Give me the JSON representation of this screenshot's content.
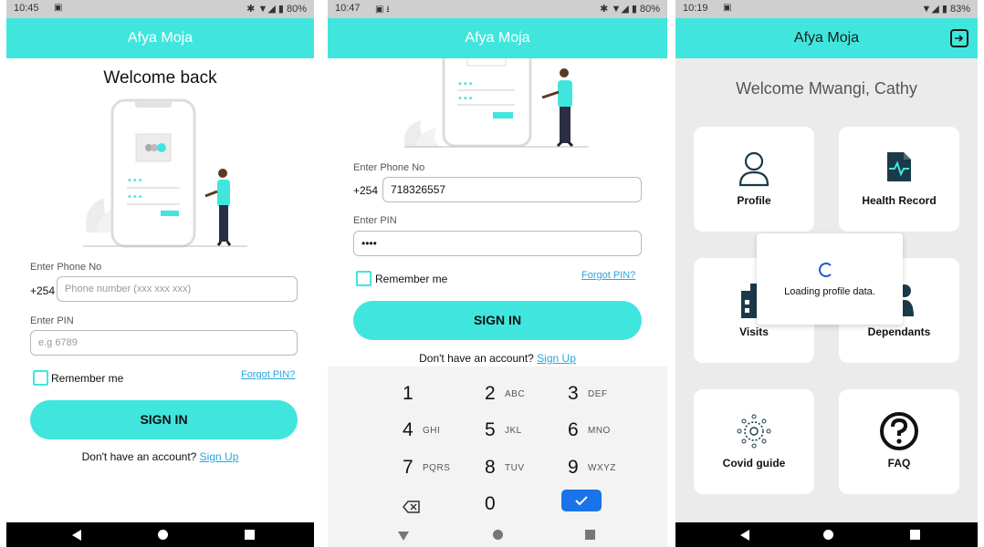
{
  "screen1": {
    "status": {
      "time": "10:45",
      "battery": "80%"
    },
    "app_title": "Afya Moja",
    "welcome": "Welcome back",
    "phone_label": "Enter Phone No",
    "phone_prefix": "+254",
    "phone_placeholder": "Phone number (xxx xxx xxx)",
    "pin_label": "Enter PIN",
    "pin_placeholder": "e.g 6789",
    "remember": "Remember me",
    "forgot": "Forgot PIN?",
    "signin": "SIGN IN",
    "no_account": "Don't have an account?",
    "signup": "Sign Up"
  },
  "screen2": {
    "status": {
      "time": "10:47",
      "battery": "80%"
    },
    "app_title": "Afya Moja",
    "phone_label": "Enter Phone No",
    "phone_prefix": "+254",
    "phone_value": "718326557",
    "pin_label": "Enter PIN",
    "pin_value": "••••",
    "remember": "Remember me",
    "forgot": "Forgot PIN?",
    "signin": "SIGN IN",
    "no_account": "Don't have an account?",
    "signup": "Sign Up",
    "keys": [
      {
        "num": "1",
        "letters": ""
      },
      {
        "num": "2",
        "letters": "ABC"
      },
      {
        "num": "3",
        "letters": "DEF"
      },
      {
        "num": "4",
        "letters": "GHI"
      },
      {
        "num": "5",
        "letters": "JKL"
      },
      {
        "num": "6",
        "letters": "MNO"
      },
      {
        "num": "7",
        "letters": "PQRS"
      },
      {
        "num": "8",
        "letters": "TUV"
      },
      {
        "num": "9",
        "letters": "WXYZ"
      },
      {
        "num": "0",
        "letters": ""
      }
    ]
  },
  "screen3": {
    "status": {
      "time": "10:19",
      "battery": "83%"
    },
    "app_title": "Afya Moja",
    "welcome": "Welcome Mwangi, Cathy",
    "cards": {
      "profile": "Profile",
      "health_record": "Health Record",
      "visits": "Visits",
      "dependants": "Dependants",
      "covid": "Covid guide",
      "faq": "FAQ"
    },
    "loading": "Loading profile data."
  },
  "colors": {
    "accent": "#40e6dd",
    "link": "#29a7d8",
    "keypad_done": "#1a73e8"
  }
}
